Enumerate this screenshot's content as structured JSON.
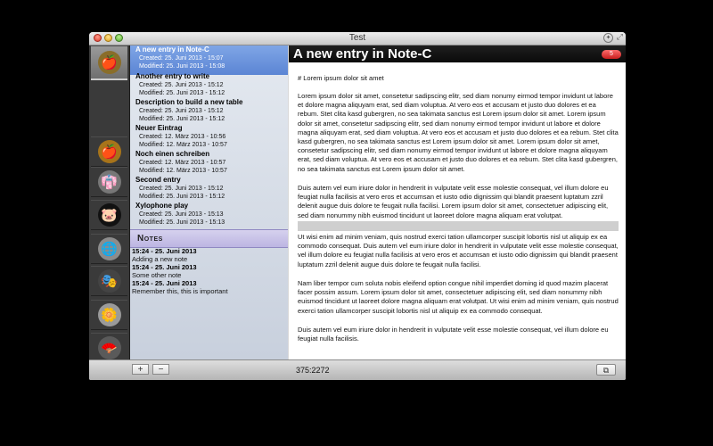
{
  "window": {
    "title": "Test"
  },
  "icons": [
    {
      "name": "golden-apple-icon",
      "glyph": "🍎",
      "bg": "#8a6d2a"
    },
    {
      "name": "apple-icon",
      "glyph": "🍎",
      "bg": "#a8741a"
    },
    {
      "name": "kimono-icon",
      "glyph": "👘",
      "bg": "#777777"
    },
    {
      "name": "piggy-bank-icon",
      "glyph": "🐷",
      "bg": "#111111"
    },
    {
      "name": "globe-icon",
      "glyph": "🌐",
      "bg": "#8c8c8c"
    },
    {
      "name": "mask-icon",
      "glyph": "🎭",
      "bg": "#444444"
    },
    {
      "name": "flower-icon",
      "glyph": "🌼",
      "bg": "#9a9a9a"
    },
    {
      "name": "fan-icon",
      "glyph": "🪭",
      "bg": "#5a5a5a"
    }
  ],
  "entries": [
    {
      "title": "A new entry in Note-C",
      "created": "Created: 25. Juni 2013 - 15:07",
      "modified": "Modified: 25. Juni 2013 - 15:08",
      "selected": true
    },
    {
      "title": "Another entry to write",
      "created": "Created: 25. Juni 2013 - 15:12",
      "modified": "Modified: 25. Juni 2013 - 15:12"
    },
    {
      "title": "Description to build a new table",
      "created": "Created: 25. Juni 2013 - 15:12",
      "modified": "Modified: 25. Juni 2013 - 15:12"
    },
    {
      "title": "Neuer Eintrag",
      "created": "Created: 12. März 2013 - 10:56",
      "modified": "Modified: 12. März 2013 - 10:57"
    },
    {
      "title": "Noch einen schreiben",
      "created": "Created: 12. März 2013 - 10:57",
      "modified": "Modified: 12. März 2013 - 10:57"
    },
    {
      "title": "Second entry",
      "created": "Created: 25. Juni 2013 - 15:12",
      "modified": "Modified: 25. Juni 2013 - 15:12"
    },
    {
      "title": "Xylophone play",
      "created": "Created: 25. Juni 2013 - 15:13",
      "modified": "Modified: 25. Juni 2013 - 15:13"
    }
  ],
  "notes": {
    "header": "Notes",
    "items": [
      {
        "time": "15:24 - 25. Juni 2013",
        "text": "Adding a new note"
      },
      {
        "time": "15:24 - 25. Juni 2013",
        "text": "Some other note"
      },
      {
        "time": "15:24 - 25. Juni 2013",
        "text": "Remember this, this is important"
      }
    ]
  },
  "editor": {
    "title": "A new entry in Note-C",
    "badge": "5",
    "paragraphs": [
      "# Lorem ipsum dolor sit amet",
      "Lorem ipsum dolor sit amet, consetetur sadipscing elitr, sed diam nonumy eirmod tempor invidunt ut labore et dolore magna aliquyam erat, sed diam voluptua. At vero eos et accusam et justo duo dolores et ea rebum. Stet clita kasd gubergren, no sea takimata sanctus est Lorem ipsum dolor sit amet. Lorem ipsum dolor sit amet, consetetur sadipscing elitr, sed diam nonumy eirmod tempor invidunt ut labore et dolore magna aliquyam erat, sed diam voluptua. At vero eos et accusam et justo duo dolores et ea rebum. Stet clita kasd gubergren, no sea takimata sanctus est Lorem ipsum dolor sit amet. Lorem ipsum dolor sit amet, consetetur sadipscing elitr, sed diam nonumy eirmod tempor invidunt ut labore et dolore magna aliquyam erat, sed diam voluptua. At vero eos et accusam et justo duo dolores et ea rebum. Stet clita kasd gubergren, no sea takimata sanctus est Lorem ipsum dolor sit amet.",
      "Duis autem vel eum iriure dolor in hendrerit in vulputate velit esse molestie consequat, vel illum dolore eu feugiat nulla facilisis at vero eros et accumsan et iusto odio dignissim qui blandit praesent luptatum zzril delenit augue duis dolore te feugait nulla facilisi. Lorem ipsum dolor sit amet, consectetuer adipiscing elit, sed diam nonummy nibh euismod tincidunt ut laoreet dolore magna aliquam erat volutpat.",
      "Ut wisi enim ad minim veniam, quis nostrud exerci tation ullamcorper suscipit lobortis nisl ut aliquip ex ea commodo consequat. Duis autem vel eum iriure dolor in hendrerit in vulputate velit esse molestie consequat, vel illum dolore eu feugiat nulla facilisis at vero eros et accumsan et iusto odio dignissim qui blandit praesent luptatum zzril delenit augue duis dolore te feugait nulla facilisi.",
      "Nam liber tempor cum soluta nobis eleifend option congue nihil imperdiet doming id quod mazim placerat facer possim assum. Lorem ipsum dolor sit amet, consectetuer adipiscing elit, sed diam nonummy nibh euismod tincidunt ut laoreet dolore magna aliquam erat volutpat. Ut wisi enim ad minim veniam, quis nostrud exerci tation ullamcorper suscipit lobortis nisl ut aliquip ex ea commodo consequat.",
      "Duis autem vel eum iriure dolor in hendrerit in vulputate velit esse molestie consequat, vel illum dolore eu feugiat nulla facilisis."
    ]
  },
  "bottom": {
    "add_label": "+",
    "remove_label": "−",
    "counter": "375:2272",
    "copy_glyph": "⧉"
  }
}
